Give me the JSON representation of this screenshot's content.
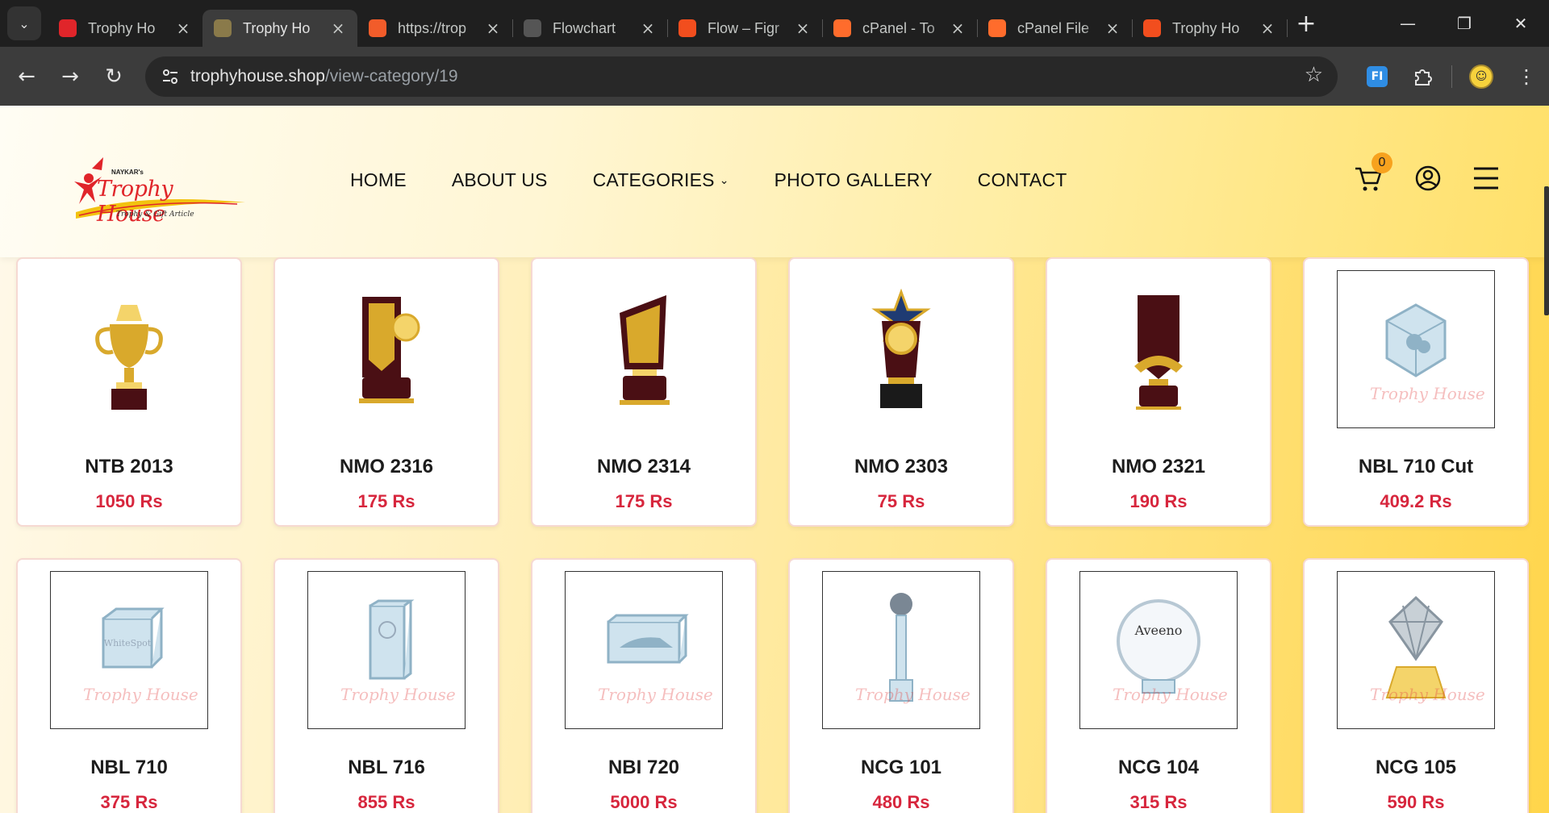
{
  "browser": {
    "tabs": [
      {
        "title": "Trophy Ho",
        "active": false,
        "favicon": "trophyhouse-logo-icon",
        "color": "#e0252a"
      },
      {
        "title": "Trophy Ho",
        "active": true,
        "favicon": "trophy-icon",
        "color": "#8a7a4a"
      },
      {
        "title": "https://trop",
        "active": false,
        "favicon": "edit-brush-icon",
        "color": "#f25c2a"
      },
      {
        "title": "Flowchart",
        "active": false,
        "favicon": "openai-icon",
        "color": "#555555"
      },
      {
        "title": "Flow – Figr",
        "active": false,
        "favicon": "figma-icon",
        "color": "#f24e1e"
      },
      {
        "title": "cPanel - To",
        "active": false,
        "favicon": "cpanel-icon",
        "color": "#ff6c2c"
      },
      {
        "title": "cPanel File",
        "active": false,
        "favicon": "cpanel-icon",
        "color": "#ff6c2c"
      },
      {
        "title": "Trophy Ho",
        "active": false,
        "favicon": "figma-icon",
        "color": "#f24e1e"
      }
    ],
    "url_host": "trophyhouse.shop",
    "url_path": "/view-category/19"
  },
  "site": {
    "logo": {
      "small": "NAYKAR's",
      "main": "Trophy House",
      "tagline": "Trophy & Gift Article"
    },
    "nav": {
      "home": "HOME",
      "about": "ABOUT US",
      "categories": "CATEGORIES",
      "gallery": "PHOTO GALLERY",
      "contact": "CONTACT"
    },
    "cart_count": "0",
    "accent_color": "#d7263d"
  },
  "products": [
    {
      "name": "NTB 2013",
      "price": "1050 Rs",
      "image": "gold-cup-trophy",
      "framed": false
    },
    {
      "name": "NMO 2316",
      "price": "175 Rs",
      "image": "wood-gold-plaque-medal",
      "framed": false
    },
    {
      "name": "NMO 2314",
      "price": "175 Rs",
      "image": "wood-gold-flag-trophy",
      "framed": false
    },
    {
      "name": "NMO 2303",
      "price": "75 Rs",
      "image": "star-wreath-trophy",
      "framed": false
    },
    {
      "name": "NMO 2321",
      "price": "190 Rs",
      "image": "maroon-wing-trophy",
      "framed": false
    },
    {
      "name": "NBL 710 Cut",
      "price": "409.2 Rs",
      "image": "crystal-cube-cut",
      "framed": true
    },
    {
      "name": "NBL 710",
      "price": "375 Rs",
      "image": "crystal-cube",
      "framed": true
    },
    {
      "name": "NBL 716",
      "price": "855 Rs",
      "image": "crystal-block",
      "framed": true
    },
    {
      "name": "NBI 720",
      "price": "5000 Rs",
      "image": "crystal-car-block",
      "framed": true
    },
    {
      "name": "NCG 101",
      "price": "480 Rs",
      "image": "crystal-pillar-trophy",
      "framed": true
    },
    {
      "name": "NCG 104",
      "price": "315 Rs",
      "image": "crystal-round-plaque",
      "framed": true
    },
    {
      "name": "NCG 105",
      "price": "590 Rs",
      "image": "crystal-diamond-gold-base",
      "framed": true
    }
  ],
  "watermark": "Trophy House"
}
